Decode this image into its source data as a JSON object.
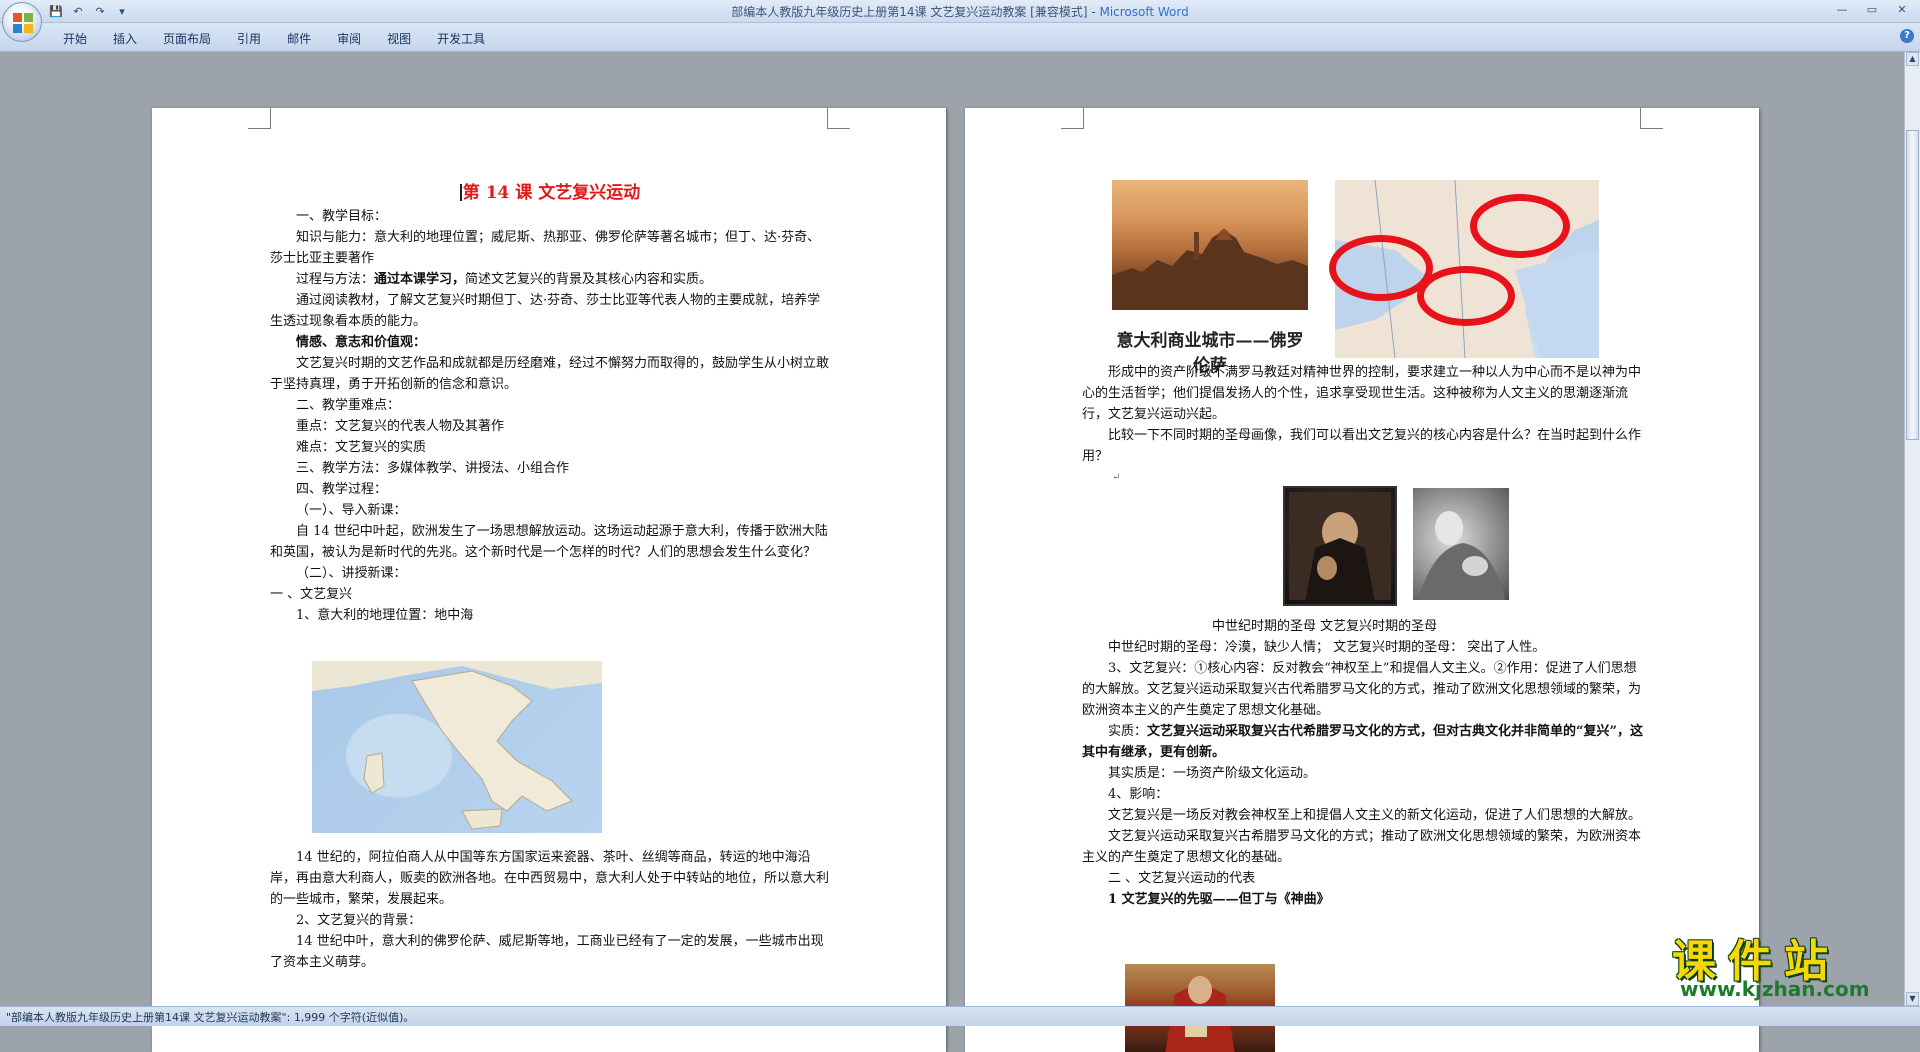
{
  "window": {
    "title": "部编本人教版九年级历史上册第14课  文艺复兴运动教案 [兼容模式] - ",
    "brand": "Microsoft Word",
    "controls": [
      "—",
      "▭",
      "✕"
    ]
  },
  "ribbon": {
    "tabs": [
      "开始",
      "插入",
      "页面布局",
      "引用",
      "邮件",
      "审阅",
      "视图",
      "开发工具"
    ],
    "help": "?"
  },
  "qat": {
    "save": "💾",
    "undo": "↶",
    "redo": "↷",
    "more": "▾"
  },
  "left_page": {
    "heading": "第 14 课    文艺复兴运动",
    "lines": [
      "一、教学目标：",
      "知识与能力：意大利的地理位置；威尼斯、热那亚、佛罗伦萨等著名城市；但丁、达·芬奇、莎士比亚主要著作",
      "过程与方法：",
      "通过本课学习，",
      "简述文艺复兴的背景及其核心内容和实质。",
      "通过阅读教材，了解文艺复兴时期但丁、达·芬奇、莎士比亚等代表人物的主要成就，培养学生透过现象看本质的能力。",
      "情感、意志和价值观：",
      "文艺复兴时期的文艺作品和成就都是历经磨难，经过不懈努力而取得的，鼓励学生从小树立敢于坚持真理，勇于开拓创新的信念和意识。",
      "二、教学重难点：",
      "重点：文艺复兴的代表人物及其著作",
      "难点：文艺复兴的实质",
      "三、教学方法：多媒体教学、讲授法、小组合作",
      "四、教学过程：",
      "（一）、导入新课：",
      "自 14 世纪中叶起，欧洲发生了一场思想解放运动。这场运动起源于意大利，传播于欧洲大陆和英国，被认为是新时代的先兆。这个新时代是一个怎样的时代？人们的思想会发生什么变化？",
      "（二）、讲授新课：",
      "一  、文艺复兴",
      "1、意大利的地理位置：地中海",
      "14 世纪的，阿拉伯商人从中国等东方国家运来瓷器、茶叶、丝绸等商品，转运的地中海沿岸，再由意大利商人，贩卖的欧洲各地。在中西贸易中，意大利人处于中转站的地位，所以意大利的一些城市，繁荣，发展起来。",
      "2、文艺复兴的背景：",
      "14 世纪中叶，意大利的佛罗伦萨、威尼斯等地，工商业已经有了一定的发展，一些城市出现了资本主义萌芽。"
    ]
  },
  "right_page": {
    "florence_caption": "意大利商业城市——佛罗伦萨",
    "lines": [
      "形成中的资产阶级不满罗马教廷对精神世界的控制，要求建立一种以人为中心而不是以神为中心的生活哲学；他们提倡发扬人的个性，追求享受现世生活。这种被称为人文主义的思潮逐渐流行，文艺复兴运动兴起。",
      "比较一下不同时期的圣母画像，我们可以看出文艺复兴的核心内容是什么？在当时起到什么作用？",
      "中世纪时期的圣母      文艺复兴时期的圣母",
      "中世纪时期的圣母：冷漠，缺少人情；  文艺复兴时期的圣母：  突出了人性。",
      "3、文艺复兴：①核心内容：反对教会“神权至上”和提倡人文主义。②作用：促进了人们思想的大解放。文艺复兴运动采取复兴古代希腊罗马文化的方式，推动了欧洲文化思想领域的繁荣，为欧洲资本主义的产生奠定了思想文化基础。",
      "实质：",
      "文艺复兴运动采取复兴古代希腊罗马文化的方式，但对古典文化并非简单的“复兴”，这其中有继承，更有创新。",
      "其实质是：一场资产阶级文化运动。",
      "4、影响：",
      "文艺复兴是一场反对教会神权至上和提倡人文主义的新文化运动，促进了人们思想的大解放。",
      "文艺复兴运动采取复兴古希腊罗马文化的方式；推动了欧洲文化思想领域的繁荣，为欧洲资本主义的产生奠定了思想文化的基础。",
      "二  、文艺复兴运动的代表",
      "1   文艺复兴的先驱——但丁与《神曲》"
    ]
  },
  "status": {
    "text": "\"部编本人教版九年级历史上册第14课  文艺复兴运动教案\": 1,999 个字符(近似值)。"
  },
  "watermark": {
    "chars": "课件站",
    "url": "www.kjzhan.com"
  },
  "scrollbar": {
    "up": "▲",
    "down": "▼"
  }
}
